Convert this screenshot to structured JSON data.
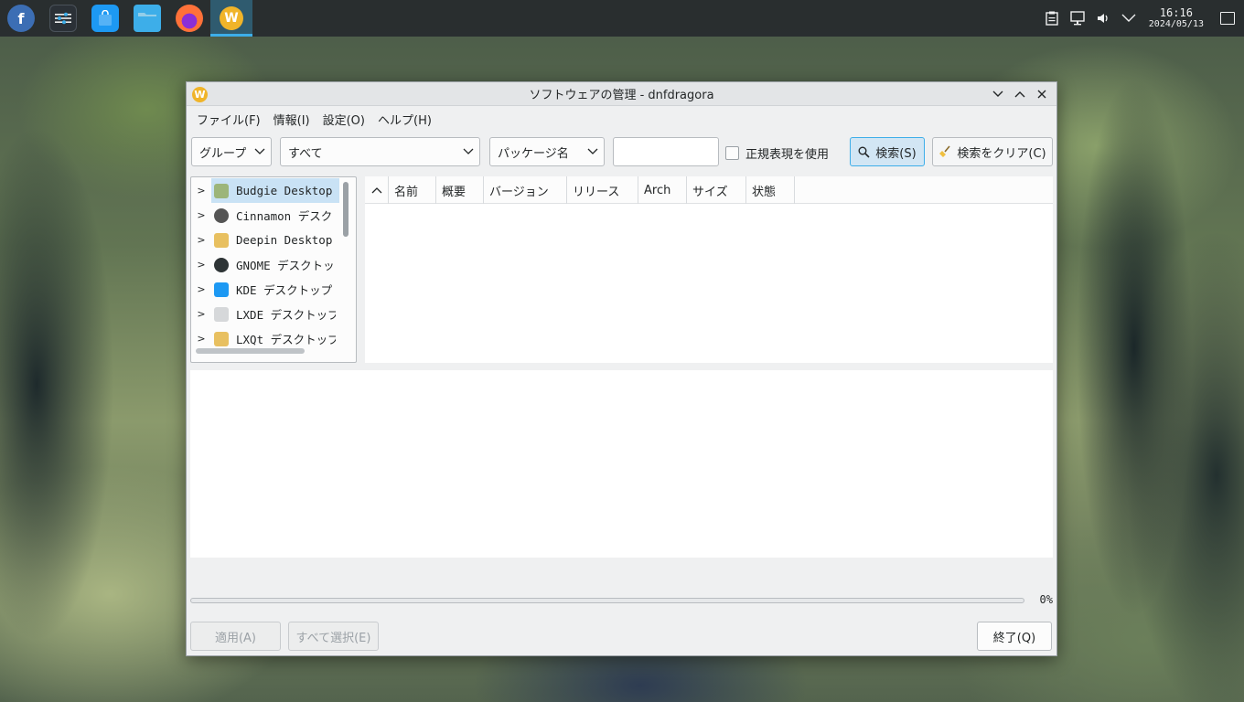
{
  "taskbar": {
    "apps": [
      {
        "name": "fedora-launcher",
        "glyph": "f"
      },
      {
        "name": "system-settings",
        "glyph": "⚙"
      },
      {
        "name": "software-store",
        "glyph": "▣"
      },
      {
        "name": "file-manager",
        "glyph": "▤"
      },
      {
        "name": "firefox",
        "glyph": ""
      },
      {
        "name": "dnfdragora",
        "glyph": "W"
      }
    ],
    "clock": {
      "time": "16:16",
      "date": "2024/05/13"
    }
  },
  "window": {
    "title": "ソフトウェアの管理 - dnfdragora",
    "app_glyph": "W",
    "menu": [
      "ファイル(F)",
      "情報(I)",
      "設定(O)",
      "ヘルプ(H)"
    ],
    "toolbar": {
      "view_combo": "グループ",
      "filter_combo": "すべて",
      "search_by_combo": "パッケージ名",
      "search_value": "",
      "regex_label": "正規表現を使用",
      "search_button": "検索(S)",
      "clear_button": "検索をクリア(C)"
    },
    "groups": [
      {
        "label": "Budgie Desktop",
        "icon": "budgie-icon",
        "selected": true
      },
      {
        "label": "Cinnamon デスクトップ",
        "icon": "cinnamon-icon",
        "selected": false
      },
      {
        "label": "Deepin Desktop",
        "icon": "deepin-icon",
        "selected": false
      },
      {
        "label": "GNOME デスクトップ",
        "icon": "gnome-icon",
        "selected": false
      },
      {
        "label": "KDE デスクトップ",
        "icon": "kde-icon",
        "selected": false
      },
      {
        "label": "LXDE デスクトップ",
        "icon": "lxde-icon",
        "selected": false
      },
      {
        "label": "LXQt デスクトップ",
        "icon": "lxqt-icon",
        "selected": false
      }
    ],
    "table_headers": [
      "名前",
      "概要",
      "バージョン",
      "リリース",
      "Arch",
      "サイズ",
      "状態"
    ],
    "progress": {
      "value": 0,
      "text": "0%"
    },
    "buttons": {
      "apply": "適用(A)",
      "select_all": "すべて選択(E)",
      "quit": "終了(Q)"
    }
  }
}
